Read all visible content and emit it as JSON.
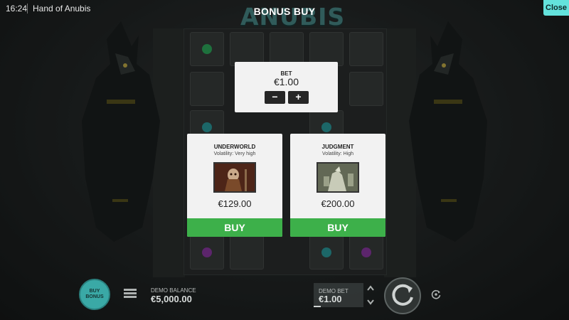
{
  "top_bar": {
    "time": "16:24",
    "game_name": "Hand of Anubis",
    "close_label": "Close"
  },
  "logo_text": "ANUBIS",
  "bonus_buy_title": "BONUS BUY",
  "bet": {
    "label": "BET",
    "value": "€1.00",
    "minus_label": "−",
    "plus_label": "+"
  },
  "offers": [
    {
      "name": "UNDERWORLD",
      "volatility": "Volatility: Very high",
      "price": "€129.00",
      "buy_label": "BUY"
    },
    {
      "name": "JUDGMENT",
      "volatility": "Volatility: High",
      "price": "€200.00",
      "buy_label": "BUY"
    }
  ],
  "bottom_bar": {
    "buy_bonus_label": "BUY BONUS",
    "balance_label": "DEMO BALANCE",
    "balance_value": "€5,000.00",
    "bet_label": "DEMO BET",
    "bet_value": "€1.00"
  },
  "icons": {
    "menu": "menu-icon",
    "spin": "spin-icon",
    "autoplay": "autoplay-icon",
    "bet_arrows": "chevron-up-down-icon"
  },
  "colors": {
    "close_button": "#63e2dc",
    "buy_button": "#3db04a",
    "buy_bonus_button": "#3aa9a6",
    "logo": "#4a8c8a"
  }
}
